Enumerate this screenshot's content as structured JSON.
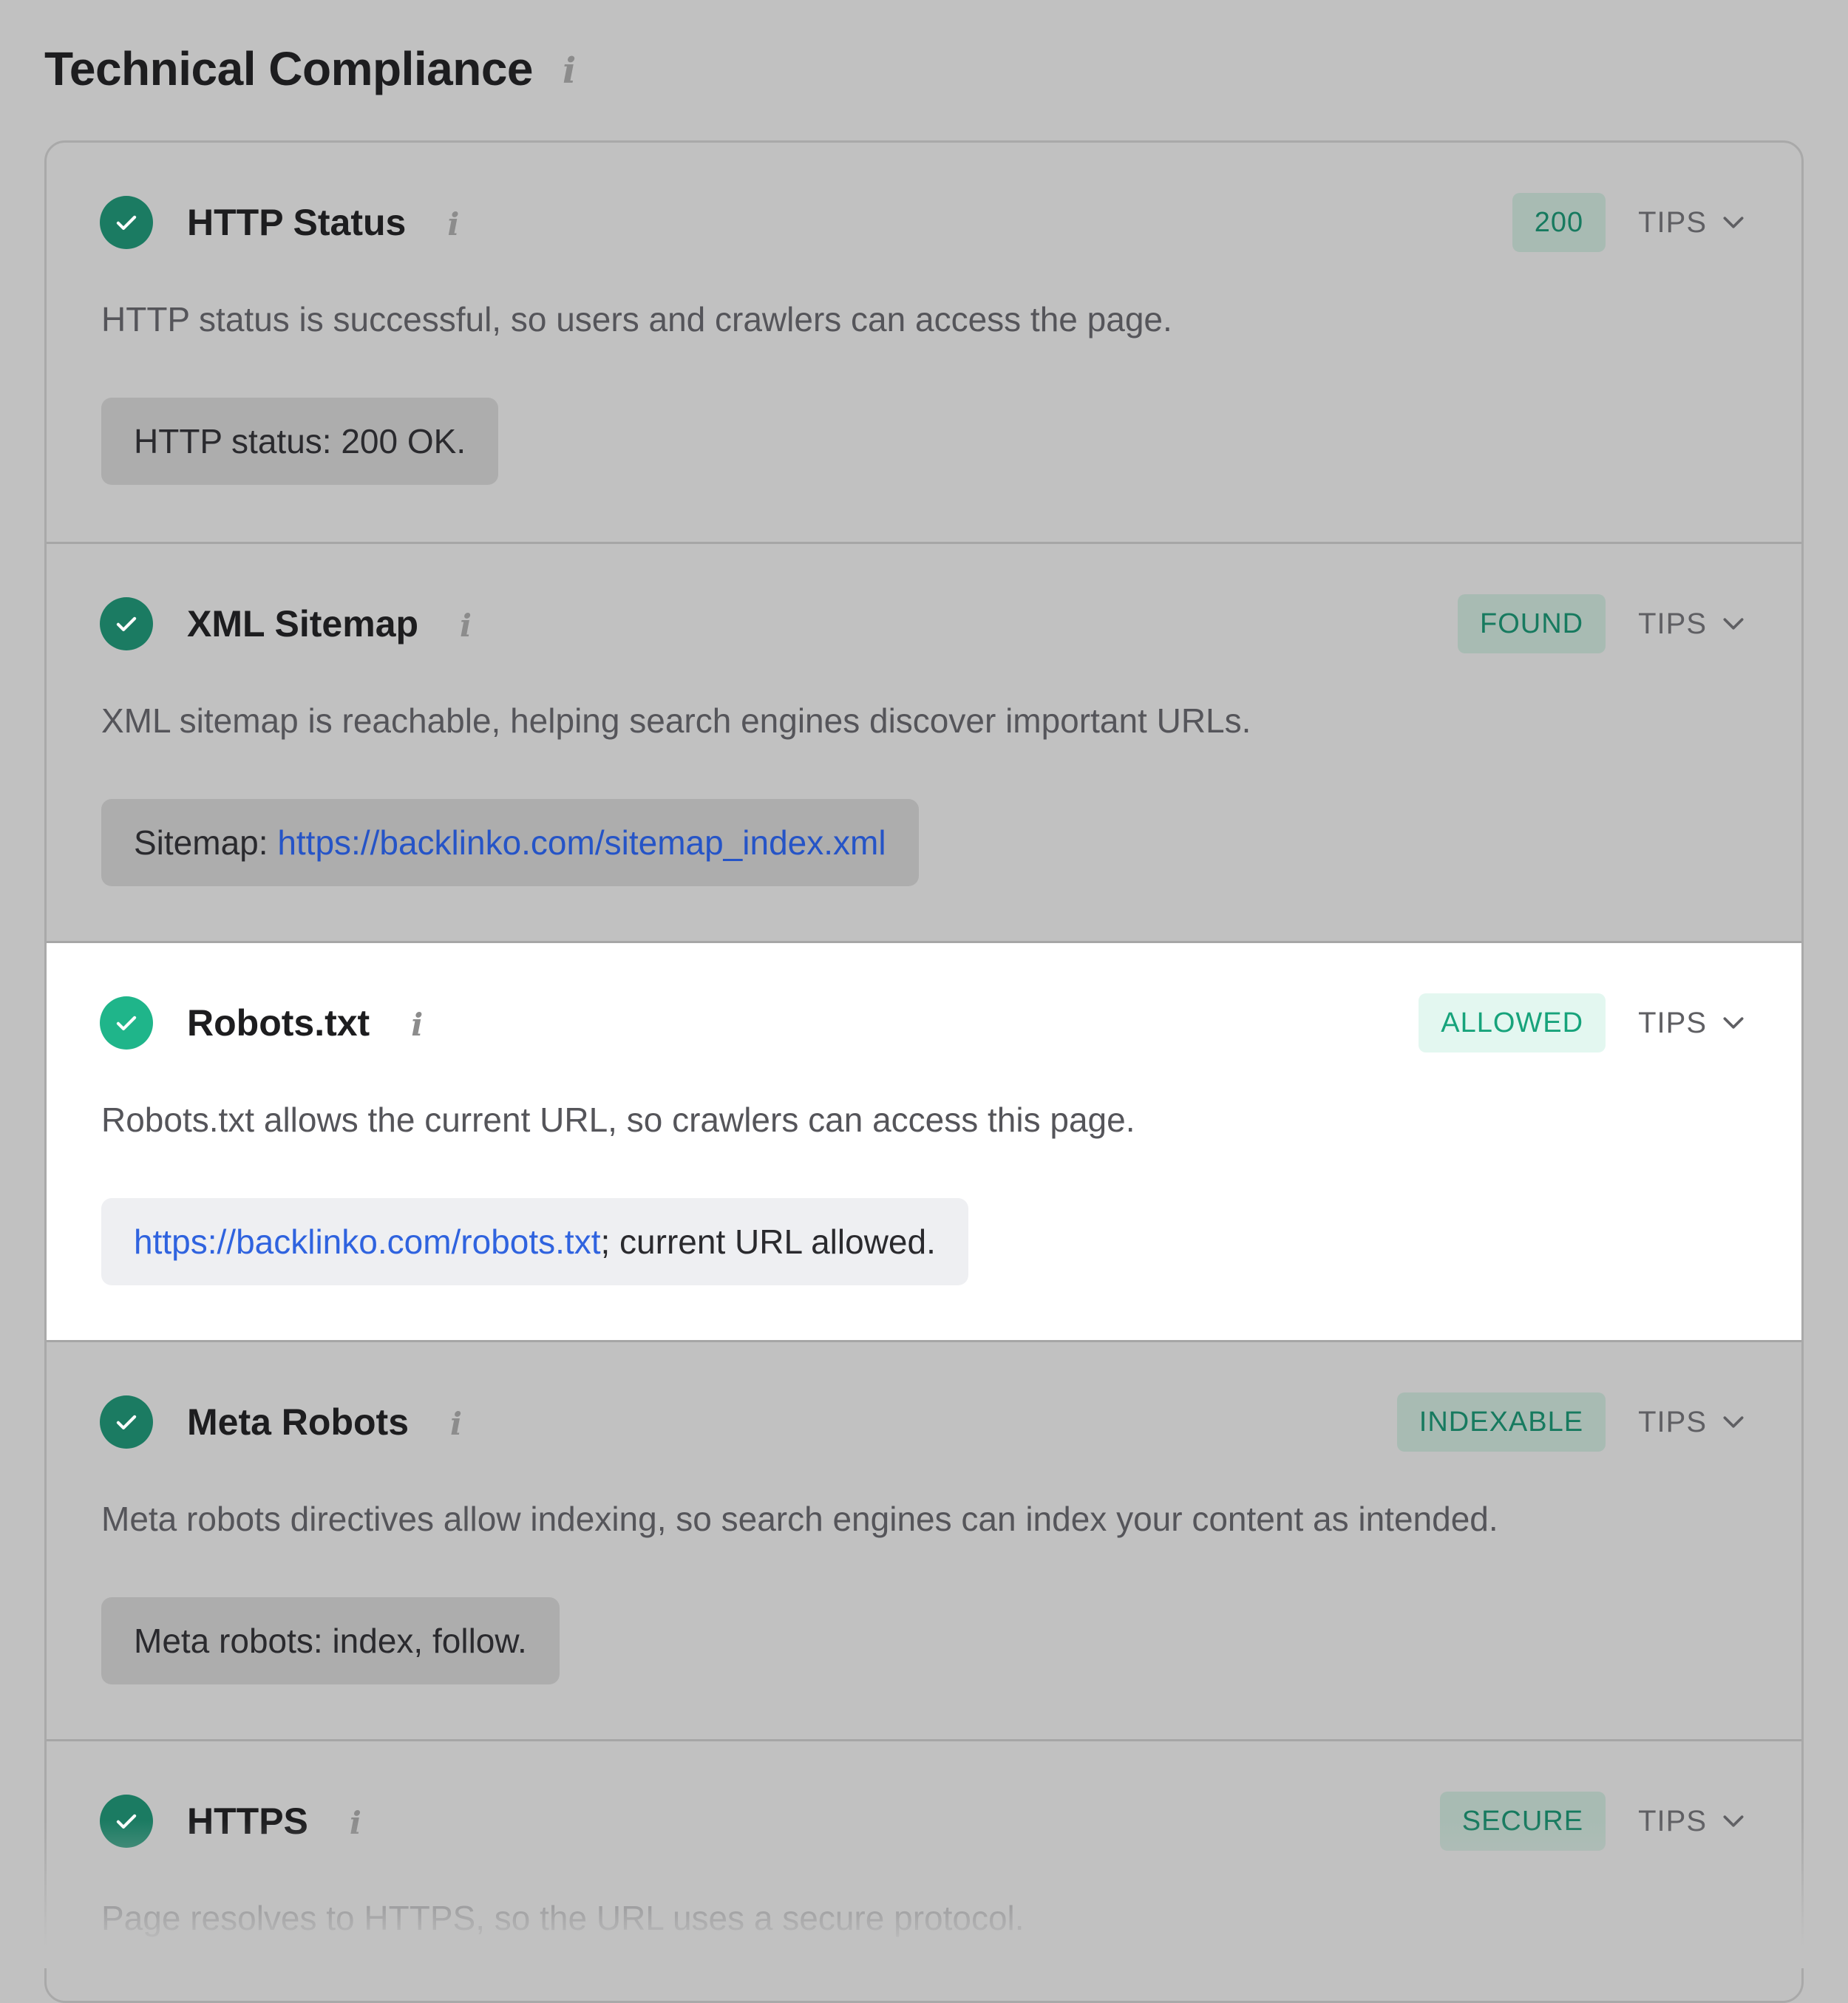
{
  "page": {
    "title": "Technical Compliance",
    "title_info_icon": "info-icon"
  },
  "colors": {
    "background_dimmed": "#c1c1c1",
    "check_green": "#1b7b62",
    "check_green_active": "#1fb58a",
    "badge_text": "#177a5f",
    "link": "#2f63df"
  },
  "checks": [
    {
      "title": "HTTP Status",
      "badge": "200",
      "tips_label": "TIPS",
      "description": "HTTP status is successful, so users and crawlers can access the page.",
      "detail_prefix": "HTTP status: 200 OK.",
      "detail_link": "",
      "detail_suffix": "",
      "icon": "check-circle-icon",
      "highlighted": false
    },
    {
      "title": "XML Sitemap",
      "badge": "FOUND",
      "tips_label": "TIPS",
      "description": "XML sitemap is reachable, helping search engines discover important URLs.",
      "detail_prefix": "Sitemap: ",
      "detail_link": "https://backlinko.com/sitemap_index.xml",
      "detail_suffix": "",
      "icon": "check-circle-icon",
      "highlighted": false
    },
    {
      "title": "Robots.txt",
      "badge": "ALLOWED",
      "tips_label": "TIPS",
      "description": "Robots.txt allows the current URL, so crawlers can access this page.",
      "detail_prefix": "",
      "detail_link": "https://backlinko.com/robots.txt",
      "detail_suffix": "; current URL allowed.",
      "icon": "check-circle-icon",
      "highlighted": true
    },
    {
      "title": "Meta Robots",
      "badge": "INDEXABLE",
      "tips_label": "TIPS",
      "description": "Meta robots directives allow indexing, so search engines can index your content as intended.",
      "detail_prefix": "Meta robots: index, follow.",
      "detail_link": "",
      "detail_suffix": "",
      "icon": "check-circle-icon",
      "highlighted": false
    },
    {
      "title": "HTTPS",
      "badge": "SECURE",
      "tips_label": "TIPS",
      "description": "Page resolves to HTTPS, so the URL uses a secure protocol.",
      "detail_prefix": "",
      "detail_link": "",
      "detail_suffix": "",
      "icon": "check-circle-icon",
      "highlighted": false
    }
  ]
}
